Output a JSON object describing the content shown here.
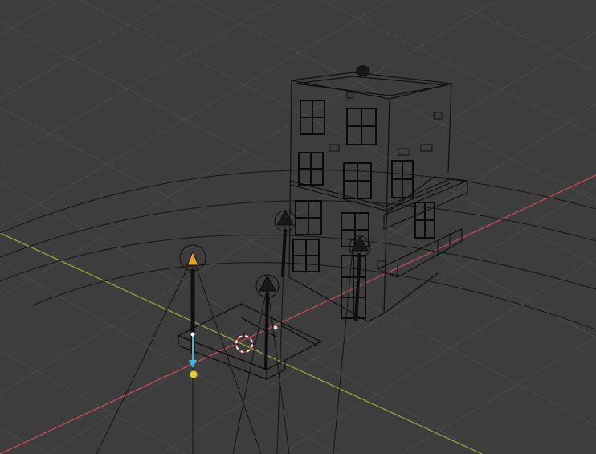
{
  "viewport": {
    "mode": "wireframe",
    "background_color": "#3d3d3d",
    "grid_color": "#4a4a4a",
    "wire_color": "#111111",
    "x_axis_color": "#c24a55",
    "y_axis_color": "#8aa83a"
  },
  "scene": {
    "objects": [
      {
        "name": "building",
        "type": "mesh"
      },
      {
        "name": "balcony",
        "type": "mesh"
      },
      {
        "name": "sidewalk",
        "type": "mesh"
      },
      {
        "name": "street-lamp-1",
        "type": "mesh"
      },
      {
        "name": "street-lamp-2",
        "type": "mesh"
      },
      {
        "name": "street-lamp-3",
        "type": "mesh"
      },
      {
        "name": "street-lamp-4",
        "type": "mesh"
      },
      {
        "name": "spot-light",
        "type": "light",
        "color": "#e0a030"
      },
      {
        "name": "light-direction-handle",
        "type": "gizmo",
        "color": "#3fb8e0"
      },
      {
        "name": "light-target",
        "type": "gizmo",
        "color": "#e0d040"
      },
      {
        "name": "3d-cursor",
        "type": "cursor",
        "colors": [
          "#ffffff",
          "#d04040"
        ]
      }
    ]
  }
}
